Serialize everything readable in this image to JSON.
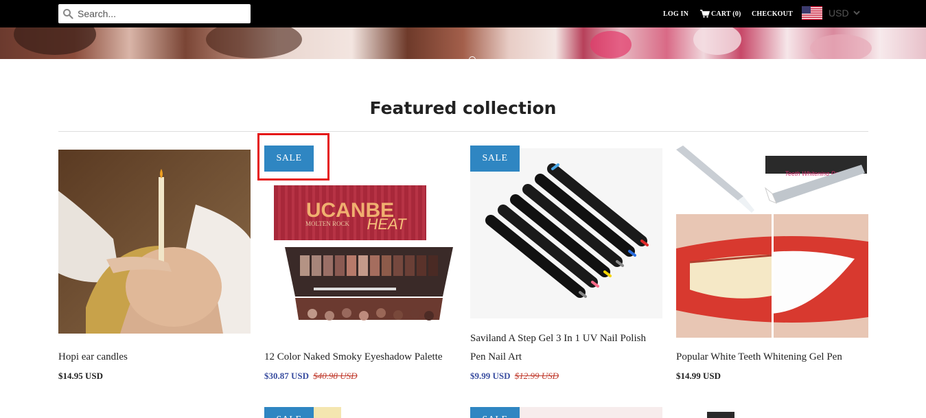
{
  "header": {
    "search": {
      "placeholder": "Search...",
      "value": ""
    },
    "nav": {
      "login": "LOG IN",
      "cart": "CART (0)",
      "checkout": "CHECKOUT"
    },
    "currency": {
      "label": "USD",
      "flag": "us-flag-icon"
    }
  },
  "main": {
    "section_title": "Featured collection",
    "products": [
      {
        "title": "Hopi ear candles",
        "price": "$14.95 USD",
        "compare_price": "",
        "on_sale": false,
        "badge": ""
      },
      {
        "title": "12 Color Naked Smoky Eyeshadow Palette",
        "price": "$30.87 USD",
        "compare_price": "$40.98 USD",
        "on_sale": true,
        "badge": "SALE"
      },
      {
        "title": "Saviland A Step Gel 3 In 1 UV Nail Polish Pen Nail Art",
        "price": "$9.99 USD",
        "compare_price": "$12.99 USD",
        "on_sale": true,
        "badge": "SALE"
      },
      {
        "title": "Popular White Teeth Whitening Gel Pen",
        "price": "$14.99 USD",
        "compare_price": "",
        "on_sale": false,
        "badge": ""
      }
    ],
    "product_images": {
      "palette_brand": "UCANBE",
      "palette_subtitle": "MOLTEN ROCK",
      "palette_name": "HEAT",
      "teeth_box_label": "Teeth Whitening Pen"
    },
    "row2_badges": [
      "SALE",
      "SALE"
    ]
  },
  "colors": {
    "topbar": "#000000",
    "sale_badge": "#2f86c2",
    "sale_price": "#3a4ea0",
    "compare_price": "#c0392b",
    "highlight": "#e51717"
  }
}
